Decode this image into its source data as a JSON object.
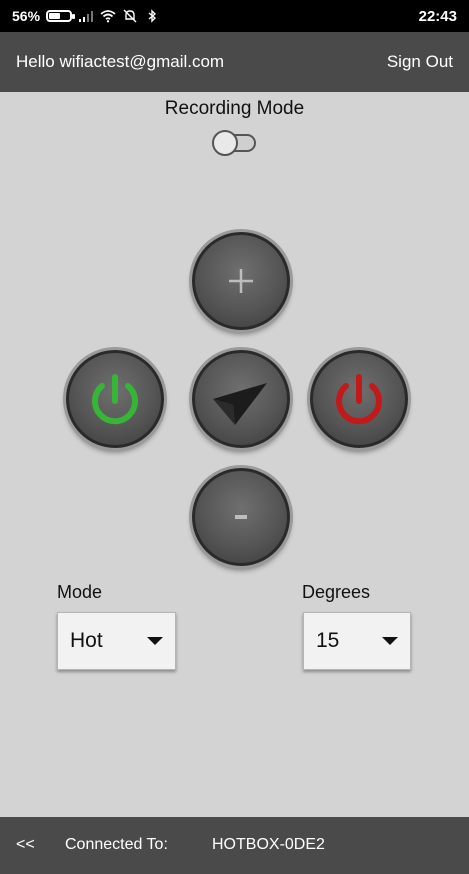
{
  "status_bar": {
    "battery_percent": "56%",
    "battery_level": 0.54,
    "time": "22:43",
    "icons": [
      "battery-icon",
      "signal-icon",
      "wifi-icon",
      "muted-alarm-icon",
      "bluetooth-icon"
    ]
  },
  "app_bar": {
    "greeting": "Hello wifiactest@gmail.com",
    "sign_out": "Sign Out",
    "background": "#4a4a4a"
  },
  "recording": {
    "title": "Recording Mode",
    "enabled": false
  },
  "controls": {
    "plus_symbol": "+",
    "minus_symbol": "-",
    "on_color": "#36b536",
    "off_color": "#c21a1a",
    "icons": [
      "plus-icon",
      "power-on-icon",
      "send-icon",
      "power-off-icon",
      "minus-icon"
    ]
  },
  "mode": {
    "label": "Mode",
    "value": "Hot"
  },
  "degrees": {
    "label": "Degrees",
    "value": "15"
  },
  "bottom_bar": {
    "back": "<<",
    "connected_label": "Connected To:",
    "device": "HOTBOX-0DE2"
  }
}
